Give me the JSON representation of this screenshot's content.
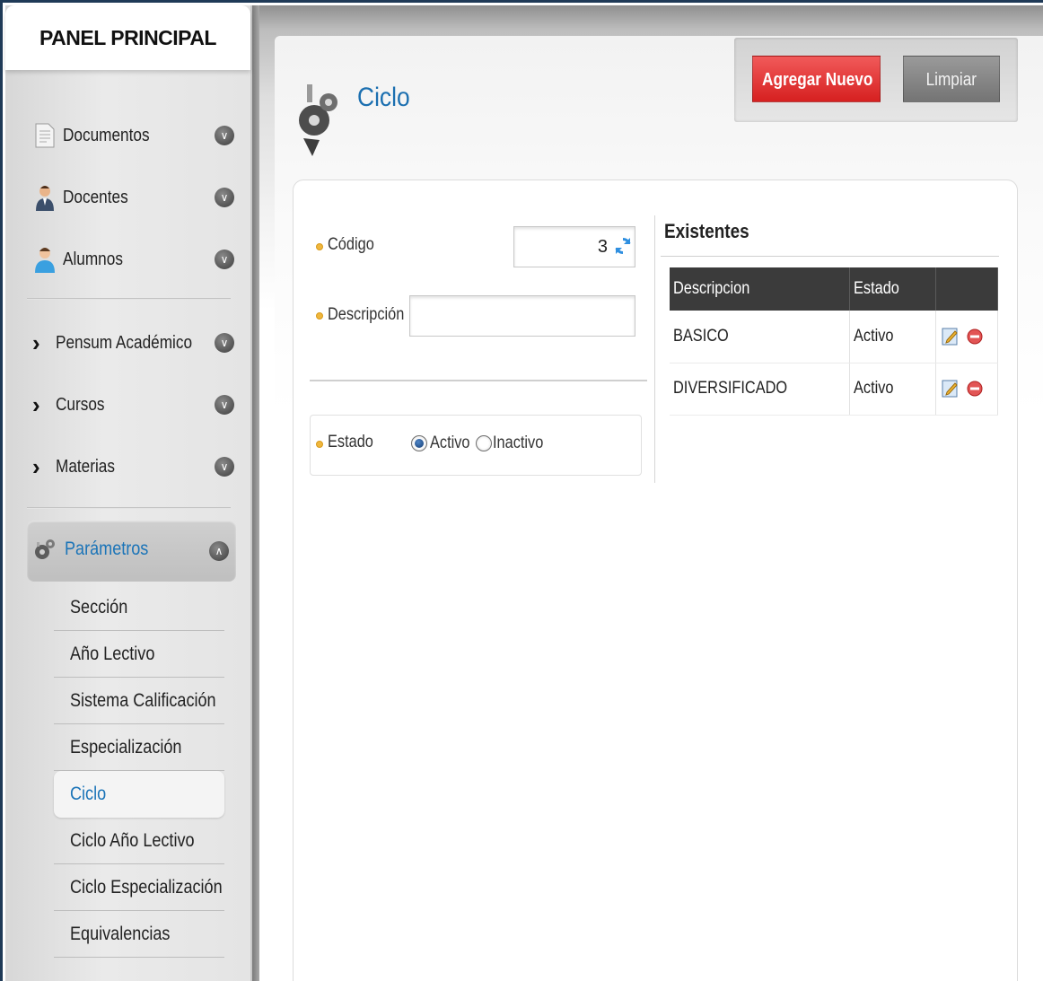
{
  "sidebar": {
    "header": "PANEL PRINCIPAL",
    "top_items": [
      {
        "label": "Documentos",
        "icon": "document-icon"
      },
      {
        "label": "Docentes",
        "icon": "teacher-icon"
      },
      {
        "label": "Alumnos",
        "icon": "student-icon"
      }
    ],
    "mid_items": [
      {
        "label": "Pensum Académico"
      },
      {
        "label": "Cursos"
      },
      {
        "label": "Materias"
      }
    ],
    "params": {
      "label": "Parámetros",
      "icon": "gears-icon",
      "items": [
        {
          "label": "Sección"
        },
        {
          "label": "Año Lectivo"
        },
        {
          "label": "Sistema Calificación"
        },
        {
          "label": "Especialización"
        },
        {
          "label": "Ciclo",
          "active": true
        },
        {
          "label": "Ciclo Año Lectivo"
        },
        {
          "label": "Ciclo Especialización"
        },
        {
          "label": "Equivalencias"
        }
      ]
    }
  },
  "page": {
    "title": "Ciclo",
    "title_icon": "gears-icon"
  },
  "toolbar": {
    "add_label": "Agregar Nuevo",
    "clear_label": "Limpiar"
  },
  "form": {
    "codigo_label": "Código",
    "codigo_value": "3",
    "descripcion_label": "Descripción",
    "descripcion_value": "",
    "estado_label": "Estado",
    "estado_options": [
      "Activo",
      "Inactivo"
    ],
    "estado_selected": "Activo"
  },
  "existentes": {
    "title": "Existentes",
    "columns": [
      "Descripcion",
      "Estado",
      ""
    ],
    "rows": [
      {
        "descripcion": "BASICO",
        "estado": "Activo"
      },
      {
        "descripcion": "DIVERSIFICADO",
        "estado": "Activo"
      }
    ]
  },
  "colors": {
    "accent": "#1b74b8",
    "add_button": "#d62020",
    "clear_button": "#7f7f7f",
    "table_header": "#3b3b3b"
  }
}
